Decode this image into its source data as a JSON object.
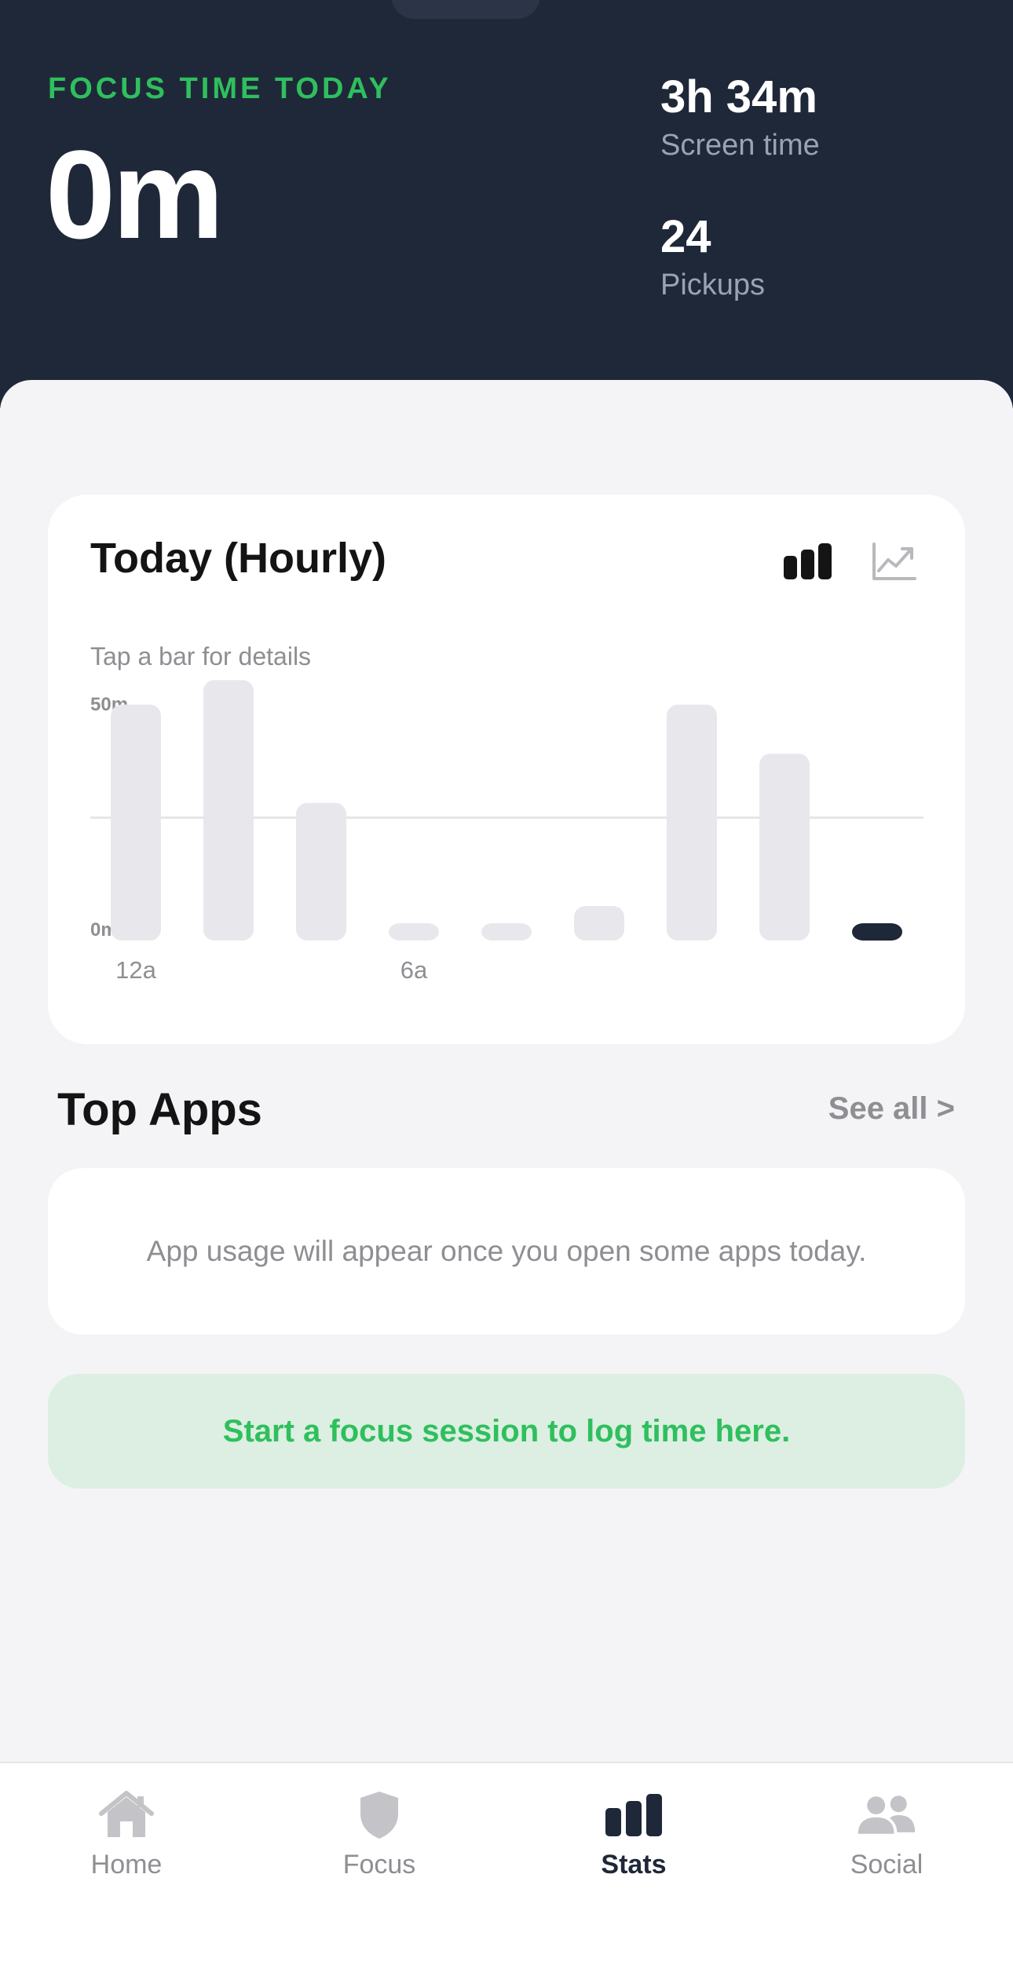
{
  "header": {
    "focus_label": "FOCUS TIME TODAY",
    "focus_value": "0m",
    "screen_time_value": "3h 34m",
    "screen_time_label": "Screen time",
    "pickups_value": "24",
    "pickups_label": "Pickups"
  },
  "chart_card": {
    "title": "Today (Hourly)",
    "hint": "Tap a bar for details",
    "view_toggle": {
      "bar_icon": "bar-chart-icon",
      "line_icon": "line-chart-icon",
      "selected": "bar"
    }
  },
  "chart_data": {
    "type": "bar",
    "ylim": [
      0,
      50
    ],
    "y_ticks": [
      "50m",
      "0m"
    ],
    "x_tick_labels": [
      "12a",
      "6a"
    ],
    "grid": "midline",
    "values": [
      48,
      53,
      28,
      2,
      2,
      7,
      48,
      38,
      2
    ],
    "highlight_index": 8,
    "colors": {
      "bar": "#e8e8ec",
      "highlight": "#1f2839",
      "grid": "#e6e6ea"
    }
  },
  "top_apps": {
    "title": "Top Apps",
    "see_all": "See all >",
    "empty_text": "App usage will appear once you open some apps today."
  },
  "cta": {
    "text": "Start a focus session to log time here."
  },
  "tabs": [
    {
      "label": "Home",
      "icon": "home-icon",
      "active": false
    },
    {
      "label": "Focus",
      "icon": "shield-icon",
      "active": false
    },
    {
      "label": "Stats",
      "icon": "stats-icon",
      "active": true
    },
    {
      "label": "Social",
      "icon": "people-icon",
      "active": false
    }
  ],
  "colors": {
    "hero_bg": "#1f2839",
    "accent_green": "#2fbf5d",
    "page_bg": "#f4f4f6"
  }
}
